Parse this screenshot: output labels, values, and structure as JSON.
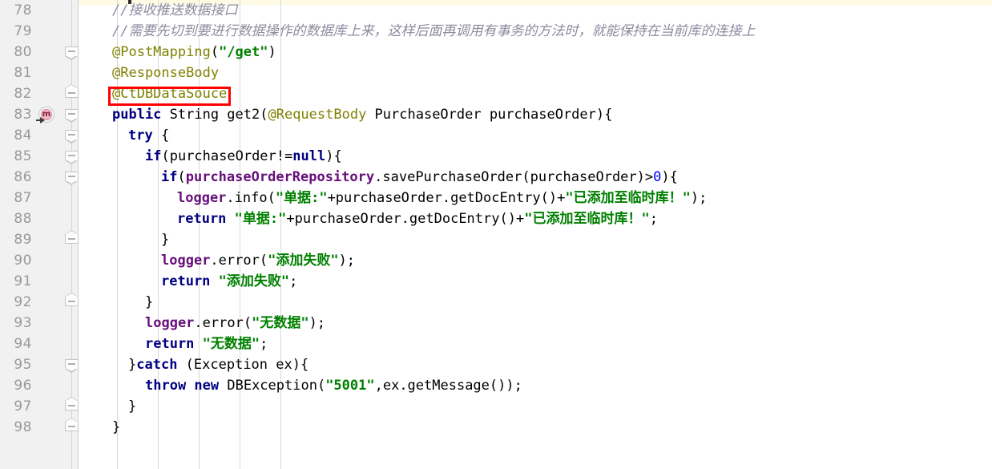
{
  "editor": {
    "app": "code-editor",
    "language": "Java",
    "first_line": 78,
    "last_line": 98,
    "colors": {
      "background": "#ffffff",
      "gutter_background": "#f1f1f1",
      "line_number": "#999999",
      "keyword": "#000080",
      "string": "#008000",
      "number": "#0000ff",
      "annotation": "#808000",
      "comment": "#8c8ca0",
      "field": "#660e7a",
      "highlight_box": "#ff0000",
      "caret_row": "#fffae3"
    }
  },
  "gutter": {
    "line_numbers": [
      "78",
      "79",
      "80",
      "81",
      "82",
      "83",
      "84",
      "85",
      "86",
      "87",
      "88",
      "89",
      "90",
      "91",
      "92",
      "93",
      "94",
      "95",
      "96",
      "97",
      "98"
    ],
    "method_marker": {
      "line": "83",
      "icon": "method-override-icon",
      "letter": "m",
      "tooltip": "Overrides method"
    },
    "fold_markers": [
      {
        "line": "80",
        "type": "cap-bot"
      },
      {
        "line": "82",
        "type": "cap-top"
      },
      {
        "line": "83",
        "type": "cap-bot"
      },
      {
        "line": "84",
        "type": "cap-bot"
      },
      {
        "line": "85",
        "type": "cap-bot"
      },
      {
        "line": "86",
        "type": "cap-bot"
      },
      {
        "line": "89",
        "type": "cap-top"
      },
      {
        "line": "92",
        "type": "cap-top"
      },
      {
        "line": "95",
        "type": "cap-bot"
      },
      {
        "line": "97",
        "type": "cap-top"
      },
      {
        "line": "98",
        "type": "cap-top"
      }
    ]
  },
  "annotation_box": {
    "target_line": "82",
    "target_text": "@CtDBDataSouce",
    "color": "#ff0000"
  },
  "code": {
    "lines": [
      {
        "n": "78",
        "indent": 2,
        "tokens": [
          {
            "t": "//接收推送数据接口",
            "c": "cmt"
          }
        ]
      },
      {
        "n": "79",
        "indent": 2,
        "tokens": [
          {
            "t": "//需要先切到要进行数据操作的数据库上来，这样后面再调用有事务的方法时，就能保持在当前库的连接上",
            "c": "cmt"
          }
        ]
      },
      {
        "n": "80",
        "indent": 2,
        "tokens": [
          {
            "t": "@PostMapping",
            "c": "ann"
          },
          {
            "t": "(",
            "c": "plain"
          },
          {
            "t": "\"/get\"",
            "c": "str"
          },
          {
            "t": ")",
            "c": "plain"
          }
        ]
      },
      {
        "n": "81",
        "indent": 2,
        "tokens": [
          {
            "t": "@ResponseBody",
            "c": "ann"
          }
        ]
      },
      {
        "n": "82",
        "indent": 2,
        "tokens": [
          {
            "t": "@CtDBDataSouce",
            "c": "ann"
          }
        ]
      },
      {
        "n": "83",
        "indent": 2,
        "tokens": [
          {
            "t": "public ",
            "c": "kw"
          },
          {
            "t": "String get2(",
            "c": "plain"
          },
          {
            "t": "@RequestBody",
            "c": "ann"
          },
          {
            "t": " PurchaseOrder purchaseOrder){",
            "c": "plain"
          }
        ]
      },
      {
        "n": "84",
        "indent": 3,
        "tokens": [
          {
            "t": "try",
            "c": "kw"
          },
          {
            "t": " {",
            "c": "plain"
          }
        ]
      },
      {
        "n": "85",
        "indent": 4,
        "tokens": [
          {
            "t": "if",
            "c": "kw"
          },
          {
            "t": "(purchaseOrder!=",
            "c": "plain"
          },
          {
            "t": "null",
            "c": "kw"
          },
          {
            "t": "){",
            "c": "plain"
          }
        ]
      },
      {
        "n": "86",
        "indent": 5,
        "tokens": [
          {
            "t": "if",
            "c": "kw"
          },
          {
            "t": "(",
            "c": "plain"
          },
          {
            "t": "purchaseOrderRepository",
            "c": "fld"
          },
          {
            "t": ".savePurchaseOrder(purchaseOrder)>",
            "c": "plain"
          },
          {
            "t": "0",
            "c": "num"
          },
          {
            "t": "){",
            "c": "plain"
          }
        ]
      },
      {
        "n": "87",
        "indent": 6,
        "tokens": [
          {
            "t": "logger",
            "c": "fld"
          },
          {
            "t": ".info(",
            "c": "plain"
          },
          {
            "t": "\"单据:\"",
            "c": "str"
          },
          {
            "t": "+purchaseOrder.getDocEntry()+",
            "c": "plain"
          },
          {
            "t": "\"已添加至临时库！\"",
            "c": "str"
          },
          {
            "t": ");",
            "c": "plain"
          }
        ]
      },
      {
        "n": "88",
        "indent": 6,
        "tokens": [
          {
            "t": "return",
            "c": "kw"
          },
          {
            "t": " ",
            "c": "plain"
          },
          {
            "t": "\"单据:\"",
            "c": "str"
          },
          {
            "t": "+purchaseOrder.getDocEntry()+",
            "c": "plain"
          },
          {
            "t": "\"已添加至临时库！\"",
            "c": "str"
          },
          {
            "t": ";",
            "c": "plain"
          }
        ]
      },
      {
        "n": "89",
        "indent": 5,
        "tokens": [
          {
            "t": "}",
            "c": "plain"
          }
        ]
      },
      {
        "n": "90",
        "indent": 5,
        "tokens": [
          {
            "t": "logger",
            "c": "fld"
          },
          {
            "t": ".error(",
            "c": "plain"
          },
          {
            "t": "\"添加失败\"",
            "c": "str"
          },
          {
            "t": ");",
            "c": "plain"
          }
        ]
      },
      {
        "n": "91",
        "indent": 5,
        "tokens": [
          {
            "t": "return",
            "c": "kw"
          },
          {
            "t": " ",
            "c": "plain"
          },
          {
            "t": "\"添加失败\"",
            "c": "str"
          },
          {
            "t": ";",
            "c": "plain"
          }
        ]
      },
      {
        "n": "92",
        "indent": 4,
        "tokens": [
          {
            "t": "}",
            "c": "plain"
          }
        ]
      },
      {
        "n": "93",
        "indent": 4,
        "tokens": [
          {
            "t": "logger",
            "c": "fld"
          },
          {
            "t": ".error(",
            "c": "plain"
          },
          {
            "t": "\"无数据\"",
            "c": "str"
          },
          {
            "t": ");",
            "c": "plain"
          }
        ]
      },
      {
        "n": "94",
        "indent": 4,
        "tokens": [
          {
            "t": "return",
            "c": "kw"
          },
          {
            "t": " ",
            "c": "plain"
          },
          {
            "t": "\"无数据\"",
            "c": "str"
          },
          {
            "t": ";",
            "c": "plain"
          }
        ]
      },
      {
        "n": "95",
        "indent": 3,
        "tokens": [
          {
            "t": "}",
            "c": "plain"
          },
          {
            "t": "catch",
            "c": "kw"
          },
          {
            "t": " (Exception ex){",
            "c": "plain"
          }
        ]
      },
      {
        "n": "96",
        "indent": 4,
        "tokens": [
          {
            "t": "throw new",
            "c": "kw"
          },
          {
            "t": " DBException(",
            "c": "plain"
          },
          {
            "t": "\"5001\"",
            "c": "str"
          },
          {
            "t": ",ex.getMessage());",
            "c": "plain"
          }
        ]
      },
      {
        "n": "97",
        "indent": 3,
        "tokens": [
          {
            "t": "}",
            "c": "plain"
          }
        ]
      },
      {
        "n": "98",
        "indent": 2,
        "tokens": [
          {
            "t": "}",
            "c": "plain"
          }
        ]
      }
    ]
  }
}
